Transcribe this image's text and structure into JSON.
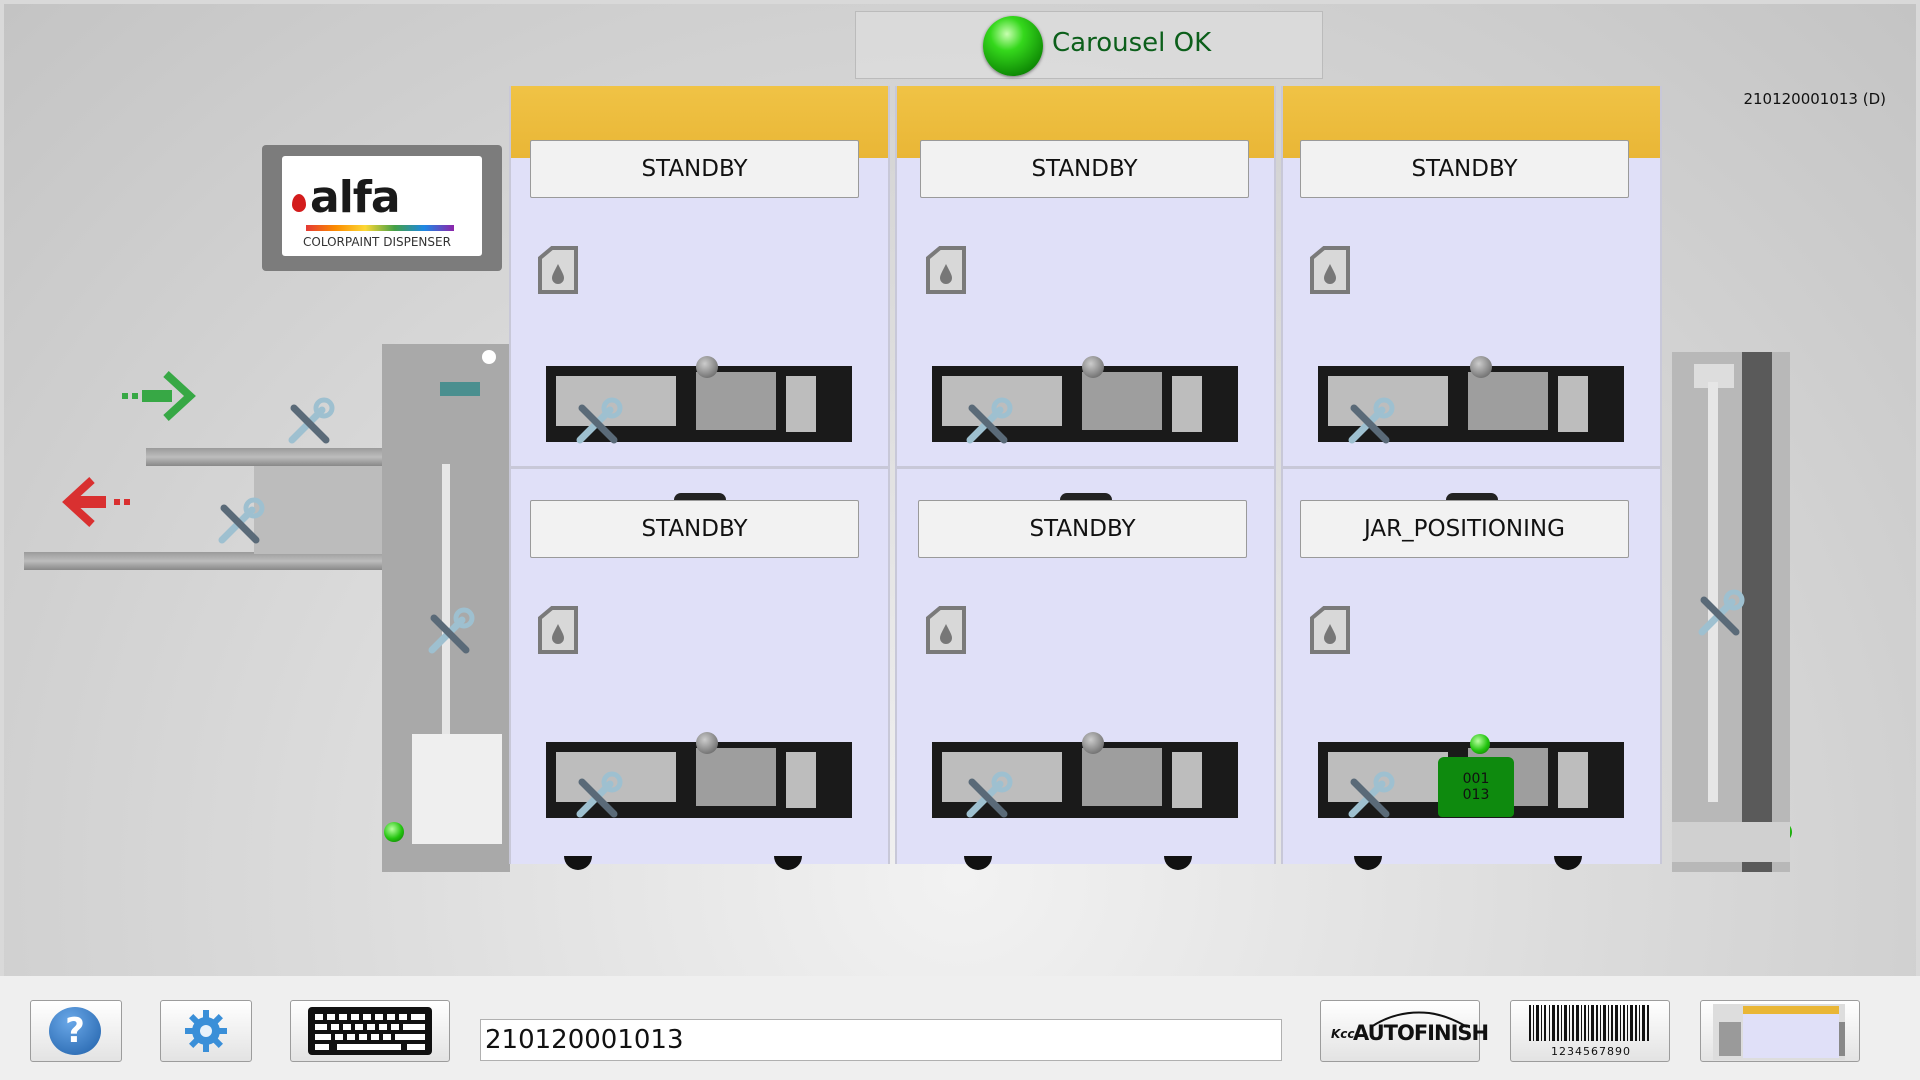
{
  "status": {
    "label": "Carousel OK",
    "color": "#25c41a"
  },
  "serial": "210120001013 (D)",
  "logo": {
    "brand": "alfa",
    "subtitle": "COLORPAINT DISPENSER"
  },
  "units": [
    {
      "state": "STANDBY"
    },
    {
      "state": "STANDBY"
    },
    {
      "state": "STANDBY"
    },
    {
      "state": "STANDBY"
    },
    {
      "state": "STANDBY"
    },
    {
      "state": "JAR_POSITIONING"
    }
  ],
  "jar_label": {
    "line1": "001",
    "line2": "013"
  },
  "icons": {
    "input_arrow": "green-dashed-right-arrow",
    "output_arrow": "red-dashed-left-arrow",
    "maintenance": "wrench-screwdriver-icon",
    "canister": "canister-drop-icon"
  },
  "toolbar": {
    "help": "?",
    "barcode_input": "210120001013",
    "brand_button": "AUTOFINISH",
    "brand_prefix": "Kcc",
    "barcode_digits": "1234567890"
  }
}
